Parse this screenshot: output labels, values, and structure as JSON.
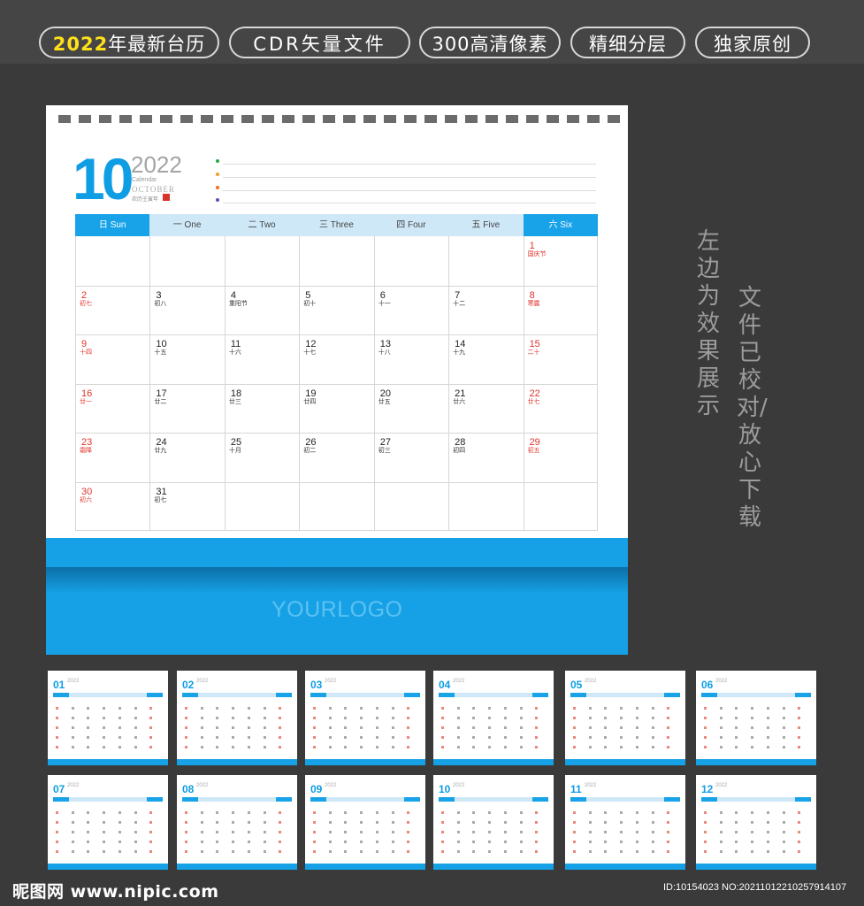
{
  "banner": {
    "tag1_year": "2022",
    "tag1_text": "年最新台历",
    "tag2": "CDR矢量文件",
    "tag3": "300高清像素",
    "tag4": "精细分层",
    "tag5": "独家原创"
  },
  "calendar": {
    "month_number": "10",
    "year": "2022",
    "label_calendar": "Calendar",
    "label_month": "OCTOBER",
    "label_lunar": "农历壬寅年",
    "weekdays": [
      "日 Sun",
      "一 One",
      "二 Two",
      "三 Three",
      "四 Four",
      "五 Five",
      "六 Six"
    ],
    "days": [
      {
        "d": "1",
        "l": "国庆节"
      },
      {
        "d": "2",
        "l": "初七"
      },
      {
        "d": "3",
        "l": "初八"
      },
      {
        "d": "4",
        "l": "重阳节"
      },
      {
        "d": "5",
        "l": "初十"
      },
      {
        "d": "6",
        "l": "十一"
      },
      {
        "d": "7",
        "l": "十二"
      },
      {
        "d": "8",
        "l": "寒露"
      },
      {
        "d": "9",
        "l": "十四"
      },
      {
        "d": "10",
        "l": "十五"
      },
      {
        "d": "11",
        "l": "十六"
      },
      {
        "d": "12",
        "l": "十七"
      },
      {
        "d": "13",
        "l": "十八"
      },
      {
        "d": "14",
        "l": "十九"
      },
      {
        "d": "15",
        "l": "二十"
      },
      {
        "d": "16",
        "l": "廿一"
      },
      {
        "d": "17",
        "l": "廿二"
      },
      {
        "d": "18",
        "l": "廿三"
      },
      {
        "d": "19",
        "l": "廿四"
      },
      {
        "d": "20",
        "l": "廿五"
      },
      {
        "d": "21",
        "l": "廿六"
      },
      {
        "d": "22",
        "l": "廿七"
      },
      {
        "d": "23",
        "l": "霜降"
      },
      {
        "d": "24",
        "l": "廿九"
      },
      {
        "d": "25",
        "l": "十月"
      },
      {
        "d": "26",
        "l": "初二"
      },
      {
        "d": "27",
        "l": "初三"
      },
      {
        "d": "28",
        "l": "初四"
      },
      {
        "d": "29",
        "l": "初五"
      },
      {
        "d": "30",
        "l": "初六"
      },
      {
        "d": "31",
        "l": "初七"
      }
    ],
    "logo": "YOURLOGO"
  },
  "side_text_1": "左边为效果展示",
  "side_text_2": "文件已校对/放心下载",
  "thumb_year": "2022",
  "thumbnails": [
    "01",
    "02",
    "03",
    "04",
    "05",
    "06",
    "07",
    "08",
    "09",
    "10",
    "11",
    "12"
  ],
  "footer": {
    "site": "昵图网 www.nipic.com",
    "id": "ID:10154023 NO:20211012210257914107"
  },
  "colors": {
    "accent_blue": "#16a1e6",
    "holiday_red": "#e0332b",
    "banner_year_yellow": "#ffe11a"
  }
}
